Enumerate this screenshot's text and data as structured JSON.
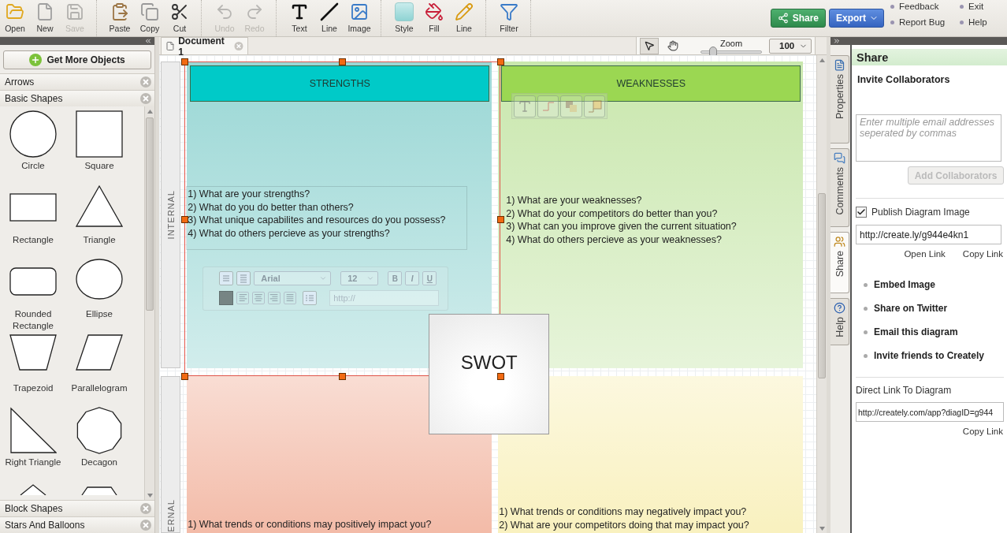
{
  "toolbar": {
    "groups": [
      {
        "items": [
          {
            "label": "Open",
            "disabled": false
          },
          {
            "label": "New",
            "disabled": false
          },
          {
            "label": "Save",
            "disabled": true
          }
        ]
      },
      {
        "items": [
          {
            "label": "Paste",
            "disabled": false
          },
          {
            "label": "Copy",
            "disabled": false
          },
          {
            "label": "Cut",
            "disabled": false
          }
        ]
      },
      {
        "items": [
          {
            "label": "Undo",
            "disabled": true
          },
          {
            "label": "Redo",
            "disabled": true
          }
        ]
      },
      {
        "items": [
          {
            "label": "Text",
            "disabled": false
          },
          {
            "label": "Line",
            "disabled": false
          },
          {
            "label": "Image",
            "disabled": false
          }
        ]
      },
      {
        "items": [
          {
            "label": "Style",
            "disabled": false
          },
          {
            "label": "Fill",
            "disabled": false
          },
          {
            "label": "Line",
            "disabled": false
          }
        ]
      },
      {
        "items": [
          {
            "label": "Filter",
            "disabled": false
          }
        ]
      }
    ],
    "share": "Share",
    "export": "Export",
    "links": [
      "Feedback",
      "Exit",
      "Report Bug",
      "Help"
    ]
  },
  "left_panel": {
    "get_more": "Get More Objects",
    "sections": [
      {
        "title": "Arrows"
      },
      {
        "title": "Basic Shapes",
        "shapes": [
          {
            "label": "Circle"
          },
          {
            "label": "Square"
          },
          {
            "label": "Rectangle"
          },
          {
            "label": "Triangle"
          },
          {
            "label": "Rounded Rectangle"
          },
          {
            "label": "Ellipse"
          },
          {
            "label": "Trapezoid"
          },
          {
            "label": "Parallelogram"
          },
          {
            "label": "Right Triangle"
          },
          {
            "label": "Decagon"
          },
          {
            "kind": "cut"
          },
          {
            "kind": "cut"
          }
        ]
      },
      {
        "title": "Block Shapes"
      },
      {
        "title": "Stars And Balloons"
      }
    ]
  },
  "document_tab": {
    "title": "Document 1"
  },
  "canvas_tools": [
    {
      "kind": "pointer",
      "selected": true
    },
    {
      "kind": "hand",
      "selected": false
    }
  ],
  "zoom": {
    "label": "Zoom",
    "level": 0.2,
    "value": "100"
  },
  "canvas": {
    "lanes": [
      "INTERNAL",
      "ERNAL"
    ],
    "quadrant_rows": [
      {
        "quadrants": [
          {
            "title": "STRENGTHS",
            "color": "#9ad7d5",
            "lines": [
              "1) What are your strengths?",
              "2) What do you do better than others?",
              "3) What unique capabilites and resources do you possess?",
              "4) What do others percieve as your strengths?"
            ]
          },
          {
            "title": "WEAKNESSES",
            "color": "#c9e7ad",
            "lines": [
              "1) What are your weaknesses?",
              "2) What do your competitors do better than you?",
              "3) What can you improve given the current situation?",
              "4) What do others percieve as your weaknesses?"
            ]
          }
        ]
      },
      {
        "quadrants": [
          {
            "color": "#f3bba8",
            "lines": [
              "1) What trends or conditions may positively impact you?"
            ]
          },
          {
            "color": "#f9f1bf",
            "lines": [
              "1) What trends or conditions may negatively impact you?",
              "2) What are your competitors doing that may impact you?"
            ]
          }
        ]
      }
    ],
    "center_title": "SWOT",
    "text_toolbar": {
      "font": "Arial",
      "size": "12",
      "styles": [
        "B",
        "I",
        "U"
      ],
      "link_placeholder": "http://"
    }
  },
  "right_panel": {
    "tabs": [
      {
        "label": "Properties",
        "selected": false
      },
      {
        "label": "Comments",
        "selected": false
      },
      {
        "label": "Share",
        "selected": true
      },
      {
        "label": "Help",
        "selected": false
      }
    ],
    "title": "Share",
    "invite_heading": "Invite Collaborators",
    "email_placeholder": "Enter multiple email addresses seperated by commas",
    "add_button": {
      "label": "Add Collaborators",
      "disabled": true
    },
    "publish": {
      "label": "Publish Diagram Image",
      "checked": true
    },
    "publish_link": "http://create.ly/g944e4kn1",
    "publish_actions": [
      "Open Link",
      "Copy Link"
    ],
    "share_options": [
      "Embed Image",
      "Share on Twitter",
      "Email this diagram",
      "Invite friends to Creately"
    ],
    "direct_link_label": "Direct Link To Diagram",
    "direct_link": "http://creately.com/app?diagID=g944",
    "direct_actions": [
      "Copy Link"
    ]
  }
}
